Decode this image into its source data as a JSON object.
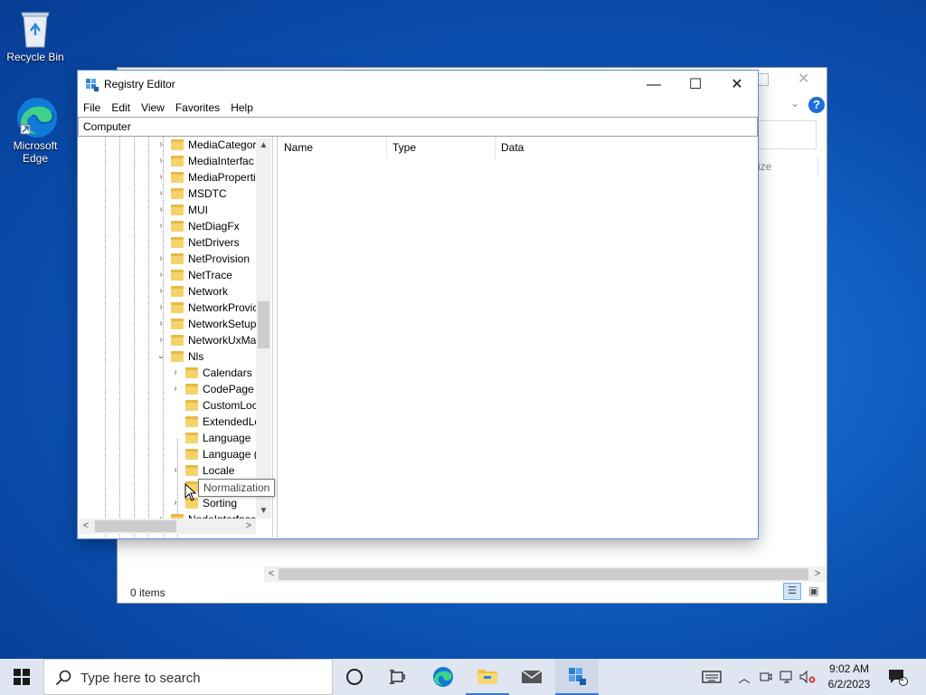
{
  "desktop": {
    "icons": [
      {
        "label": "Recycle Bin"
      },
      {
        "label": "Microsoft Edge"
      }
    ]
  },
  "explorer": {
    "status": "0 items",
    "partial_text": "ize"
  },
  "regedit": {
    "title": "Registry Editor",
    "menu": [
      "File",
      "Edit",
      "View",
      "Favorites",
      "Help"
    ],
    "address": "Computer",
    "tree": [
      {
        "label": "MediaCategor",
        "expander": ">"
      },
      {
        "label": "MediaInterfac",
        "expander": ">"
      },
      {
        "label": "MediaProperti",
        "expander": ">"
      },
      {
        "label": "MSDTC",
        "expander": ">"
      },
      {
        "label": "MUI",
        "expander": ">"
      },
      {
        "label": "NetDiagFx",
        "expander": ">"
      },
      {
        "label": "NetDrivers",
        "expander": ""
      },
      {
        "label": "NetProvision",
        "expander": ">"
      },
      {
        "label": "NetTrace",
        "expander": ">"
      },
      {
        "label": "Network",
        "expander": ">"
      },
      {
        "label": "NetworkProvic",
        "expander": ">"
      },
      {
        "label": "NetworkSetup",
        "expander": ">"
      },
      {
        "label": "NetworkUxMa",
        "expander": ">"
      },
      {
        "label": "Nls",
        "expander": "v"
      },
      {
        "label": "Calendars",
        "expander": ">"
      },
      {
        "label": "CodePage",
        "expander": ">"
      },
      {
        "label": "CustomLoc",
        "expander": ""
      },
      {
        "label": "ExtendedLo",
        "expander": ""
      },
      {
        "label": "Language",
        "expander": ""
      },
      {
        "label": "Language (",
        "expander": ""
      },
      {
        "label": "Locale",
        "expander": ">"
      },
      {
        "label": "Normalization",
        "expander": ""
      },
      {
        "label": "Sorting",
        "expander": ">"
      },
      {
        "label": "NodeInterface",
        "expander": ">"
      }
    ],
    "columns": [
      "Name",
      "Type",
      "Data"
    ],
    "tooltip": "Normalization"
  },
  "taskbar": {
    "search_placeholder": "Type here to search",
    "time": "9:02 AM",
    "date": "6/2/2023",
    "notification_count": "1"
  }
}
